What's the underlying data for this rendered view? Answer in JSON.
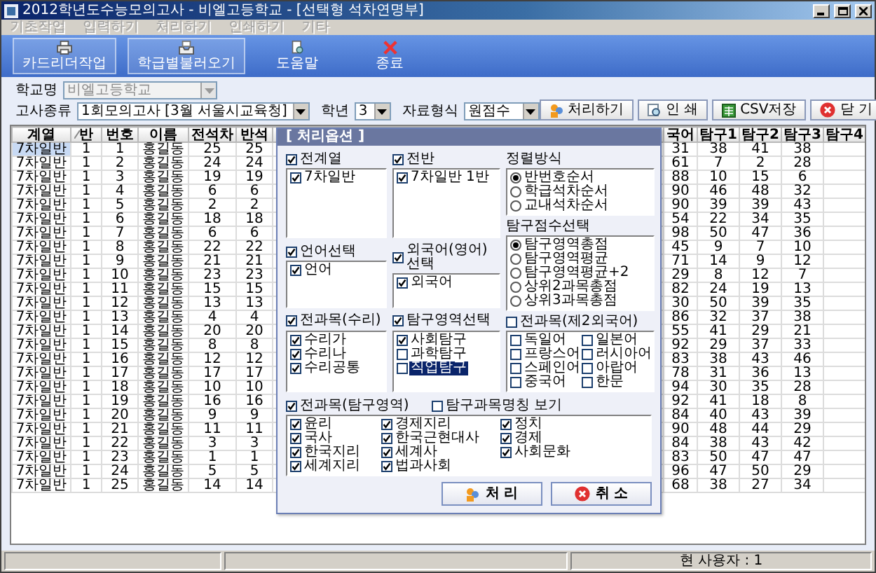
{
  "window": {
    "title": "2012학년도수능모의고사 - 비엘고등학교 - [선택형 석차연명부]"
  },
  "menu": [
    {
      "label": "기초작업",
      "disabled": true
    },
    {
      "label": "입력하기",
      "disabled": true
    },
    {
      "label": "처리하기",
      "disabled": true
    },
    {
      "label": "인쇄하기",
      "disabled": true
    },
    {
      "label": "기타",
      "disabled": true
    }
  ],
  "toolbar": [
    {
      "label": "카드리더작업",
      "kind": "reader",
      "raised": true
    },
    {
      "label": "학급별불러오기",
      "kind": "loader",
      "raised": true
    },
    {
      "label": "도움말",
      "kind": "help",
      "raised": false
    },
    {
      "label": "종료",
      "kind": "exit",
      "raised": false
    }
  ],
  "form": {
    "school": {
      "label": "학교명",
      "value": "비엘고등학교",
      "disabled": true
    },
    "exam": {
      "label": "고사종류",
      "value": "1회모의고사 [3월 서울시교육청]",
      "disabled": false
    },
    "grade": {
      "label": "학년",
      "value": "3",
      "disabled": false
    },
    "format": {
      "label": "자료형식",
      "value": "원점수",
      "disabled": false
    }
  },
  "actions": [
    {
      "label": "처리하기",
      "kind": "process"
    },
    {
      "label": "인 쇄",
      "kind": "print"
    },
    {
      "label": "CSV저장",
      "kind": "csv"
    },
    {
      "label": "닫 기",
      "kind": "close"
    }
  ],
  "table": {
    "columns": [
      {
        "label": "계열",
        "sorted": false
      },
      {
        "label": "반",
        "sorted": true
      },
      {
        "label": "번호",
        "sorted": false
      },
      {
        "label": "이름",
        "sorted": false
      },
      {
        "label": "전석차",
        "sorted": false
      },
      {
        "label": "반석",
        "sorted": false
      },
      {
        "label": "국어",
        "sorted": false
      },
      {
        "label": "탐구1",
        "sorted": false
      },
      {
        "label": "탐구2",
        "sorted": false
      },
      {
        "label": "탐구3",
        "sorted": false
      },
      {
        "label": "탐구4",
        "sorted": false
      }
    ],
    "rows": [
      {
        "selected": true,
        "cells": [
          "7차일반",
          "1",
          "1",
          "홍길동",
          "25",
          "25",
          "31",
          "38",
          "41",
          "38"
        ]
      },
      {
        "selected": false,
        "cells": [
          "7차일반",
          "1",
          "2",
          "홍길동",
          "24",
          "24",
          "61",
          "7",
          "2",
          "28"
        ]
      },
      {
        "selected": false,
        "cells": [
          "7차일반",
          "1",
          "3",
          "홍길동",
          "19",
          "19",
          "88",
          "10",
          "15",
          "6"
        ]
      },
      {
        "selected": false,
        "cells": [
          "7차일반",
          "1",
          "4",
          "홍길동",
          "6",
          "6",
          "90",
          "46",
          "48",
          "32"
        ]
      },
      {
        "selected": false,
        "cells": [
          "7차일반",
          "1",
          "5",
          "홍길동",
          "2",
          "2",
          "90",
          "39",
          "39",
          "43"
        ]
      },
      {
        "selected": false,
        "cells": [
          "7차일반",
          "1",
          "6",
          "홍길동",
          "18",
          "18",
          "54",
          "22",
          "34",
          "35"
        ]
      },
      {
        "selected": false,
        "cells": [
          "7차일반",
          "1",
          "7",
          "홍길동",
          "6",
          "6",
          "98",
          "50",
          "47",
          "36"
        ]
      },
      {
        "selected": false,
        "cells": [
          "7차일반",
          "1",
          "8",
          "홍길동",
          "22",
          "22",
          "45",
          "9",
          "7",
          "10"
        ]
      },
      {
        "selected": false,
        "cells": [
          "7차일반",
          "1",
          "9",
          "홍길동",
          "21",
          "21",
          "71",
          "14",
          "9",
          "12"
        ]
      },
      {
        "selected": false,
        "cells": [
          "7차일반",
          "1",
          "10",
          "홍길동",
          "23",
          "23",
          "29",
          "8",
          "12",
          "7"
        ]
      },
      {
        "selected": false,
        "cells": [
          "7차일반",
          "1",
          "11",
          "홍길동",
          "15",
          "15",
          "82",
          "24",
          "19",
          "13"
        ]
      },
      {
        "selected": false,
        "cells": [
          "7차일반",
          "1",
          "12",
          "홍길동",
          "13",
          "13",
          "30",
          "50",
          "39",
          "35"
        ]
      },
      {
        "selected": false,
        "cells": [
          "7차일반",
          "1",
          "13",
          "홍길동",
          "4",
          "4",
          "86",
          "32",
          "37",
          "38"
        ]
      },
      {
        "selected": false,
        "cells": [
          "7차일반",
          "1",
          "14",
          "홍길동",
          "20",
          "20",
          "55",
          "41",
          "29",
          "21"
        ]
      },
      {
        "selected": false,
        "cells": [
          "7차일반",
          "1",
          "15",
          "홍길동",
          "8",
          "8",
          "92",
          "29",
          "37",
          "33"
        ]
      },
      {
        "selected": false,
        "cells": [
          "7차일반",
          "1",
          "16",
          "홍길동",
          "12",
          "12",
          "83",
          "38",
          "43",
          "46"
        ]
      },
      {
        "selected": false,
        "cells": [
          "7차일반",
          "1",
          "17",
          "홍길동",
          "17",
          "17",
          "78",
          "31",
          "36",
          "13"
        ]
      },
      {
        "selected": false,
        "cells": [
          "7차일반",
          "1",
          "18",
          "홍길동",
          "10",
          "10",
          "94",
          "30",
          "35",
          "28"
        ]
      },
      {
        "selected": false,
        "cells": [
          "7차일반",
          "1",
          "19",
          "홍길동",
          "16",
          "16",
          "92",
          "41",
          "18",
          "8"
        ]
      },
      {
        "selected": false,
        "cells": [
          "7차일반",
          "1",
          "20",
          "홍길동",
          "9",
          "9",
          "84",
          "40",
          "43",
          "39"
        ]
      },
      {
        "selected": false,
        "cells": [
          "7차일반",
          "1",
          "21",
          "홍길동",
          "11",
          "11",
          "90",
          "48",
          "44",
          "29"
        ]
      },
      {
        "selected": false,
        "cells": [
          "7차일반",
          "1",
          "22",
          "홍길동",
          "3",
          "3",
          "84",
          "38",
          "43",
          "42"
        ]
      },
      {
        "selected": false,
        "cells": [
          "7차일반",
          "1",
          "23",
          "홍길동",
          "1",
          "1",
          "83",
          "50",
          "47",
          "47"
        ]
      },
      {
        "selected": false,
        "cells": [
          "7차일반",
          "1",
          "24",
          "홍길동",
          "5",
          "5",
          "96",
          "47",
          "50",
          "29"
        ]
      },
      {
        "selected": false,
        "cells": [
          "7차일반",
          "1",
          "25",
          "홍길동",
          "14",
          "14",
          "68",
          "38",
          "27",
          "34"
        ]
      }
    ]
  },
  "dialog": {
    "title": "[ 처리옵션 ]",
    "lists": [
      {
        "label": "전계열",
        "checked": true,
        "items": [
          {
            "label": "7차일반",
            "checked": true,
            "selected": false
          }
        ]
      },
      {
        "label": "전반",
        "checked": true,
        "items": [
          {
            "label": "7차일반 1반",
            "checked": true,
            "selected": false
          }
        ]
      },
      {
        "label": "언어선택",
        "checked": true,
        "items": [
          {
            "label": "언어",
            "checked": true,
            "selected": false
          }
        ]
      },
      {
        "label": "외국어(영어)선택",
        "checked": true,
        "items": [
          {
            "label": "외국어",
            "checked": true,
            "selected": false
          }
        ]
      },
      {
        "label": "전과목(수리)",
        "checked": true,
        "items": [
          {
            "label": "수리가",
            "checked": true,
            "selected": false
          },
          {
            "label": "수리나",
            "checked": true,
            "selected": false
          },
          {
            "label": "수리공통",
            "checked": true,
            "selected": false
          }
        ]
      },
      {
        "label": "탐구영역선택",
        "checked": true,
        "items": [
          {
            "label": "사회탐구",
            "checked": true,
            "selected": false
          },
          {
            "label": "과학탐구",
            "checked": false,
            "selected": false
          },
          {
            "label": "직업탐구",
            "checked": false,
            "selected": true
          }
        ]
      }
    ],
    "sort_order": {
      "label": "정렬방식",
      "options": [
        {
          "label": "반번호순서",
          "selected": true
        },
        {
          "label": "학급석차순서",
          "selected": false
        },
        {
          "label": "교내석차순서",
          "selected": false
        }
      ]
    },
    "score_choice": {
      "label": "탐구점수선택",
      "options": [
        {
          "label": "탐구영역총점",
          "selected": true
        },
        {
          "label": "탐구영역평균",
          "selected": false
        },
        {
          "label": "탐구영역평균+2",
          "selected": false
        },
        {
          "label": "상위2과목총점",
          "selected": false
        },
        {
          "label": "상위3과목총점",
          "selected": false
        }
      ]
    },
    "second_language": {
      "label": "전과목(제2외국어)",
      "checked": false,
      "items": [
        {
          "label": "독일어",
          "checked": false,
          "selected": false
        },
        {
          "label": "프랑스어",
          "checked": false,
          "selected": false
        },
        {
          "label": "스페인어",
          "checked": false,
          "selected": false
        },
        {
          "label": "중국어",
          "checked": false,
          "selected": false
        },
        {
          "label": "일본어",
          "checked": false,
          "selected": false
        },
        {
          "label": "러시아어",
          "checked": false,
          "selected": false
        },
        {
          "label": "아랍어",
          "checked": false,
          "selected": false
        },
        {
          "label": "한문",
          "checked": false,
          "selected": false
        }
      ]
    },
    "inquiry": {
      "label": "전과목(탐구영역)",
      "checked": true,
      "items": [
        {
          "label": "윤리",
          "checked": true,
          "selected": false
        },
        {
          "label": "국사",
          "checked": true,
          "selected": false
        },
        {
          "label": "한국지리",
          "checked": true,
          "selected": false
        },
        {
          "label": "세계지리",
          "checked": true,
          "selected": false
        },
        {
          "label": "경제지리",
          "checked": true,
          "selected": false
        },
        {
          "label": "한국근현대사",
          "checked": true,
          "selected": false
        },
        {
          "label": "세계사",
          "checked": true,
          "selected": false
        },
        {
          "label": "법과사회",
          "checked": true,
          "selected": false
        },
        {
          "label": "정치",
          "checked": true,
          "selected": false
        },
        {
          "label": "경제",
          "checked": true,
          "selected": false
        },
        {
          "label": "사회문화",
          "checked": true,
          "selected": false
        }
      ]
    },
    "show_names": {
      "label": "탐구과목명칭 보기",
      "checked": false
    },
    "buttons": [
      {
        "label": "처 리",
        "kind": "process"
      },
      {
        "label": "취 소",
        "kind": "close"
      }
    ]
  },
  "status_bar": {
    "user": "현 사용자 : 1"
  }
}
